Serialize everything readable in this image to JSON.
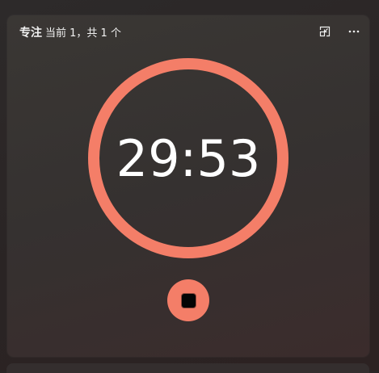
{
  "header": {
    "title": "专注",
    "subtitle": "当前 1，共 1 个"
  },
  "icons": {
    "compact": "compact-overlay-icon",
    "more": "more-options-icon",
    "stop": "stop-icon"
  },
  "timer": {
    "time": "29:53",
    "ring_progress": 1.0
  },
  "colors": {
    "accent": "#f47e68",
    "card_bg": "#373332",
    "text": "#ffffff"
  }
}
